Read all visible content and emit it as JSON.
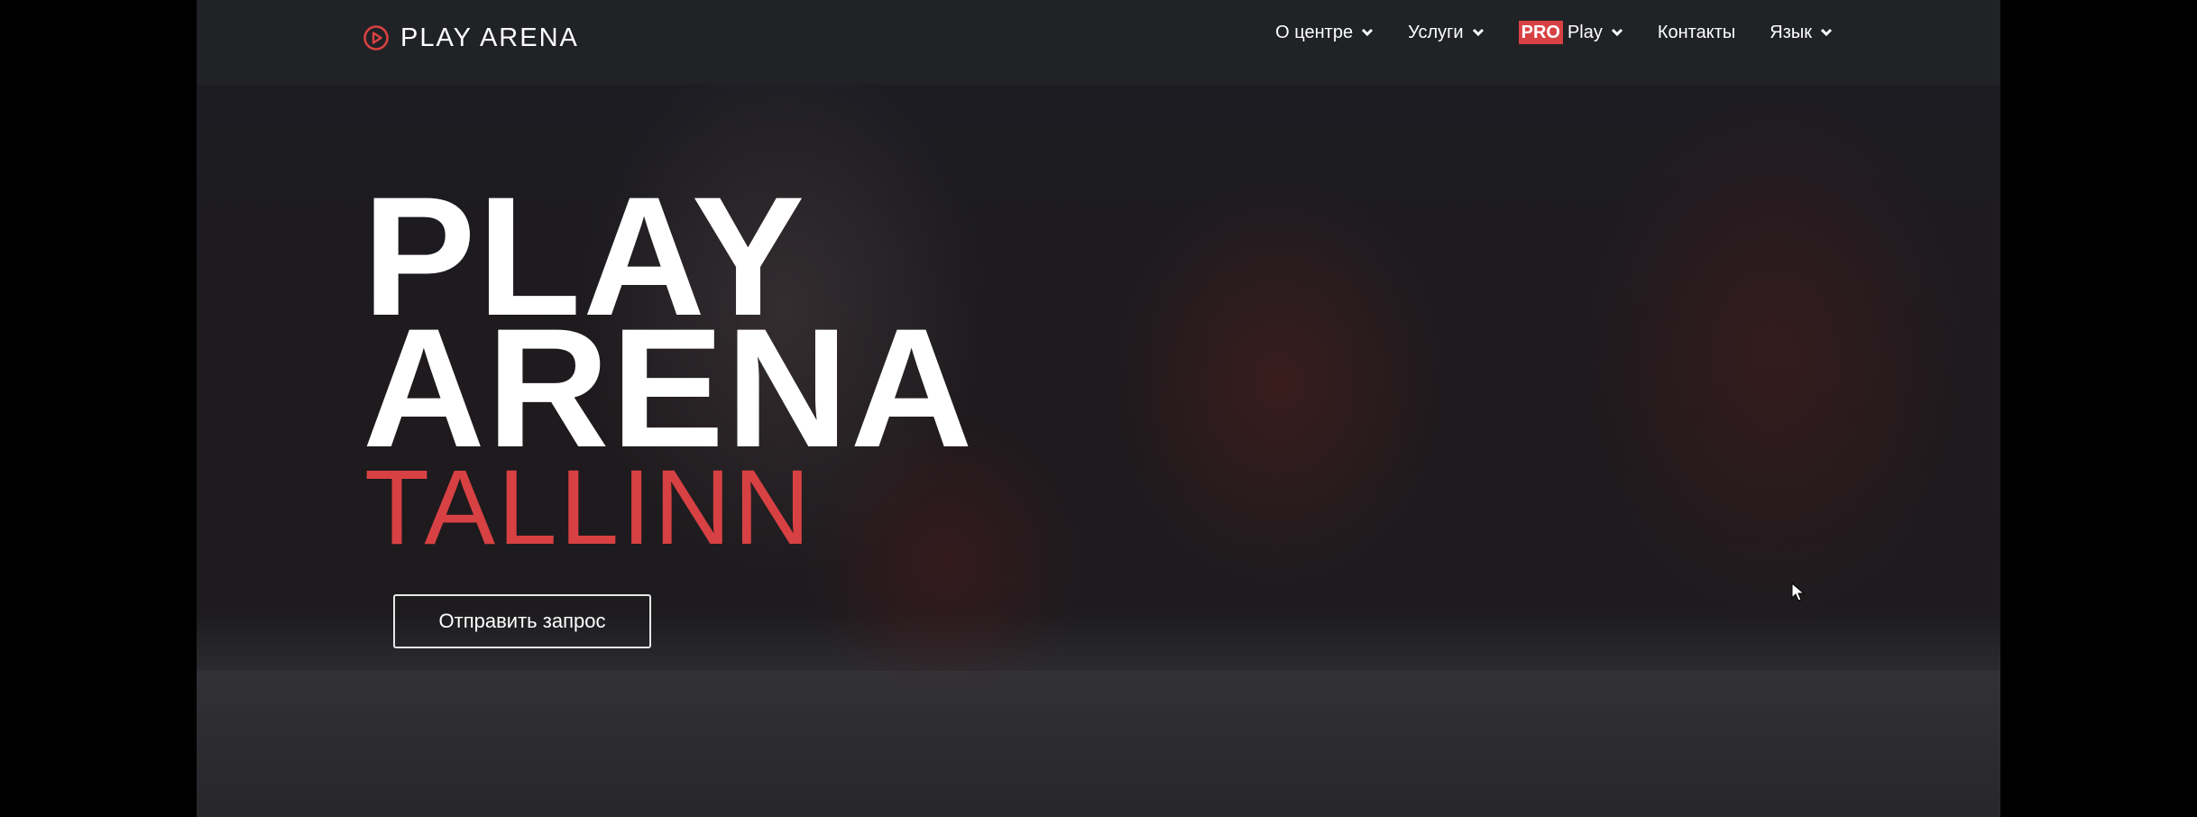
{
  "brand": {
    "logo_text": "PLAY ARENA",
    "logo_icon": "play-circle-icon",
    "accent_color": "#d84143"
  },
  "nav": {
    "items": [
      {
        "label": "О центре",
        "has_dropdown": true
      },
      {
        "label": "Услуги",
        "has_dropdown": true
      },
      {
        "badge": "PRO",
        "label": "Play",
        "has_dropdown": true
      },
      {
        "label": "Контакты",
        "has_dropdown": false
      },
      {
        "label": "Язык",
        "has_dropdown": true
      }
    ]
  },
  "hero": {
    "title_line1": "PLAY",
    "title_line2": "ARENA",
    "city": "TALLINN",
    "cta_label": "Отправить запрос"
  },
  "colors": {
    "page_background": "#000000",
    "navbar_background": "#202226",
    "text": "#ffffff"
  }
}
